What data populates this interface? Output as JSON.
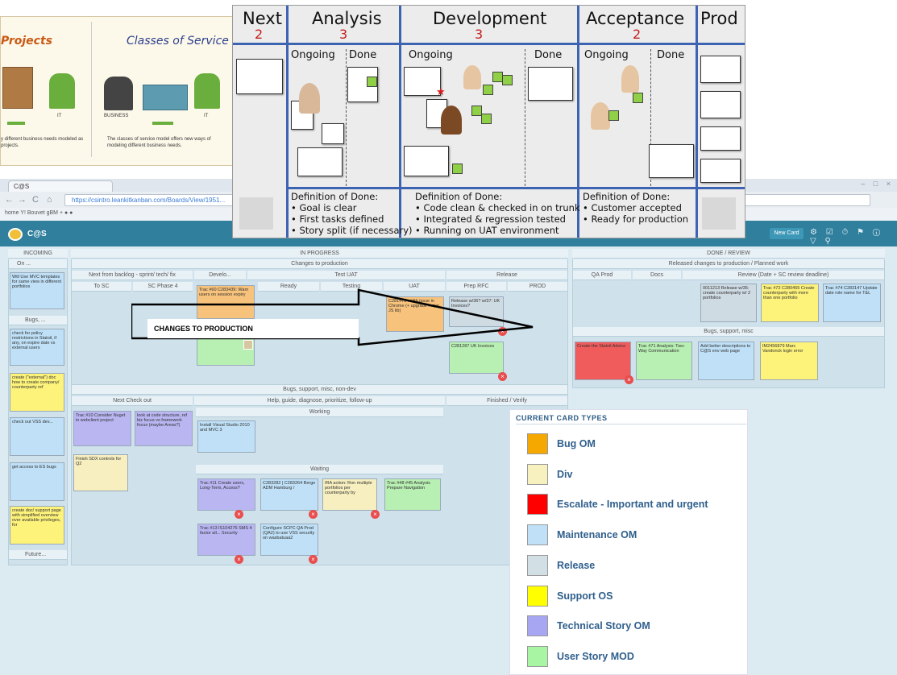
{
  "browser": {
    "tab_title": "C@S",
    "window_controls": "– □ ×",
    "nav_glyphs": [
      "←",
      "→",
      "C",
      "⌂"
    ],
    "url": "https://csintro.leankitkanban.com/Boards/View/1951...",
    "bookmarks": "home   Y!   Bouvet   gBM   +   ●   ●"
  },
  "app": {
    "title": "C@S",
    "new_card_label": "New Card",
    "header_icons": "⚙ ☑ ⏱ ⚑ ⓘ ▽ ⚲"
  },
  "board": {
    "lanes": {
      "incoming": "INCOMING",
      "in_progress": "IN PROGRESS",
      "done_review": "DONE / REVIEW",
      "changes_to_production": "Changes to production",
      "released": "Released changes to production / Planned work",
      "bugs_support_nondev": "Bugs, support, misc, non-dev",
      "bugs_support_misc": "Bugs, support, misc",
      "help_guide": "Help, guide, diagnose, prioritize, follow-up",
      "working": "Working",
      "waiting": "Waiting",
      "finished_verify": "Finished / Verify",
      "next_checkout": "Next Check out"
    },
    "columns": {
      "on": "On ...",
      "bugs": "Bugs, ...",
      "future": "Future...",
      "next_backlog": "Next from backlog - sprint/ tech/ fix",
      "develo": "Develo...",
      "test_uat": "Test UAT",
      "release": "Release",
      "to_sc": "To SC",
      "sc_phase4": "SC Phase 4",
      "ready": "Ready",
      "testing": "Testing",
      "uat": "UAT",
      "prep_rfc": "Prep RFC",
      "prod": "PROD",
      "qa_prod": "QA Prod",
      "docs": "Docs",
      "review": "Review (Date + SC review deadline)"
    },
    "cards": [
      "Will Use MVC templates for same view in different portfolios",
      "check for policy restrictions in Statoil, if any, on expire date vs external users",
      "create (\"external\") doc how to create company/ counterparty ref",
      "check out VSS dev...",
      "get access to ES bugs",
      "create doc/ support page with simplified overview over available privileges, for",
      "Trac #10 Consider Nuget in webclient project",
      "look at code structure, ref biz focus vs framework focus (maybe Areas?)",
      "Finish SDX controls for Q2",
      "Install Visual Studio 2010 and MVC 3",
      "Trac #11 Create users, Long-Term, Access?",
      "C283282 | C283264 Berge ADM Hamburg /",
      "IRA action: Ron multiple portfolios per counterparty by",
      "Trac #48 #45 Analysis Prepare Navigation",
      "Trac #13 IS104276 SMS 4 factor all... Security",
      "Configure SCPC QA Prod (QA2) to use VSS security on wasbatuaa2",
      "Trac #60 C283439: Warn users on session expiry",
      "C281473 width issue in Chrome (+ upgrade major JS lib)",
      "Release w/36? w/37: UK Invoices?",
      "C281287 UK Invoices",
      "0011213 Release w/35: create counterparty w/ 2 portfolios",
      "Trac #72 C280455 Create counterparty with more than one portfolio",
      "Trac #74 C283147 Update date role name for T&L",
      "Create the Statoil Advice",
      "Trac #71 Analysis: Two-Way Communication",
      "Add better descriptions to C@S env web page",
      "IM2456879 Marc Vandonck login error"
    ]
  },
  "overlay_arrow_label": "CHANGES TO PRODUCTION",
  "kanban_photo": {
    "columns": [
      {
        "title": "Next",
        "wip": "2"
      },
      {
        "title": "Analysis",
        "wip": "3"
      },
      {
        "title": "Development",
        "wip": "3"
      },
      {
        "title": "Acceptance",
        "wip": "2"
      },
      {
        "title": "Prod",
        "wip": ""
      }
    ],
    "subheaders": {
      "analysis_ongoing": "Ongoing",
      "analysis_done": "Done",
      "dev_ongoing": "Ongoing",
      "dev_done": "Done",
      "acc_ongoing": "Ongoing",
      "acc_done": "Done"
    },
    "dod_analysis": [
      "Definition of Done:",
      "• Goal is clear",
      "• First tasks defined",
      "• Story split (if necessary)"
    ],
    "dod_development": [
      "Definition of Done:",
      "• Code clean & checked in on trunk",
      "• Integrated & regression tested",
      "• Running on UAT environment"
    ],
    "dod_acceptance": [
      "Definition of Done:",
      "• Customer accepted",
      "• Ready for production"
    ]
  },
  "projects_slide": {
    "left_title": "Projects",
    "right_title": "Classes of Service",
    "it_label": "IT",
    "business_label": "BUSINESS",
    "it_label2": "IT",
    "left_text": "y different business needs modeled as projects.",
    "right_text": "The classes of service model offers new ways of modeling different business needs."
  },
  "legend": {
    "title": "CURRENT CARD TYPES",
    "items": [
      {
        "label": "Bug OM",
        "color": "#f5a800"
      },
      {
        "label": "Div",
        "color": "#f7f1c0"
      },
      {
        "label": "Escalate - Important and urgent",
        "color": "#ff0000"
      },
      {
        "label": "Maintenance OM",
        "color": "#bfe0f7"
      },
      {
        "label": "Release",
        "color": "#d2e0e6"
      },
      {
        "label": "Support OS",
        "color": "#ffff00"
      },
      {
        "label": "Technical Story OM",
        "color": "#a7a6f2"
      },
      {
        "label": "User Story MOD",
        "color": "#a8f5a3"
      }
    ]
  }
}
